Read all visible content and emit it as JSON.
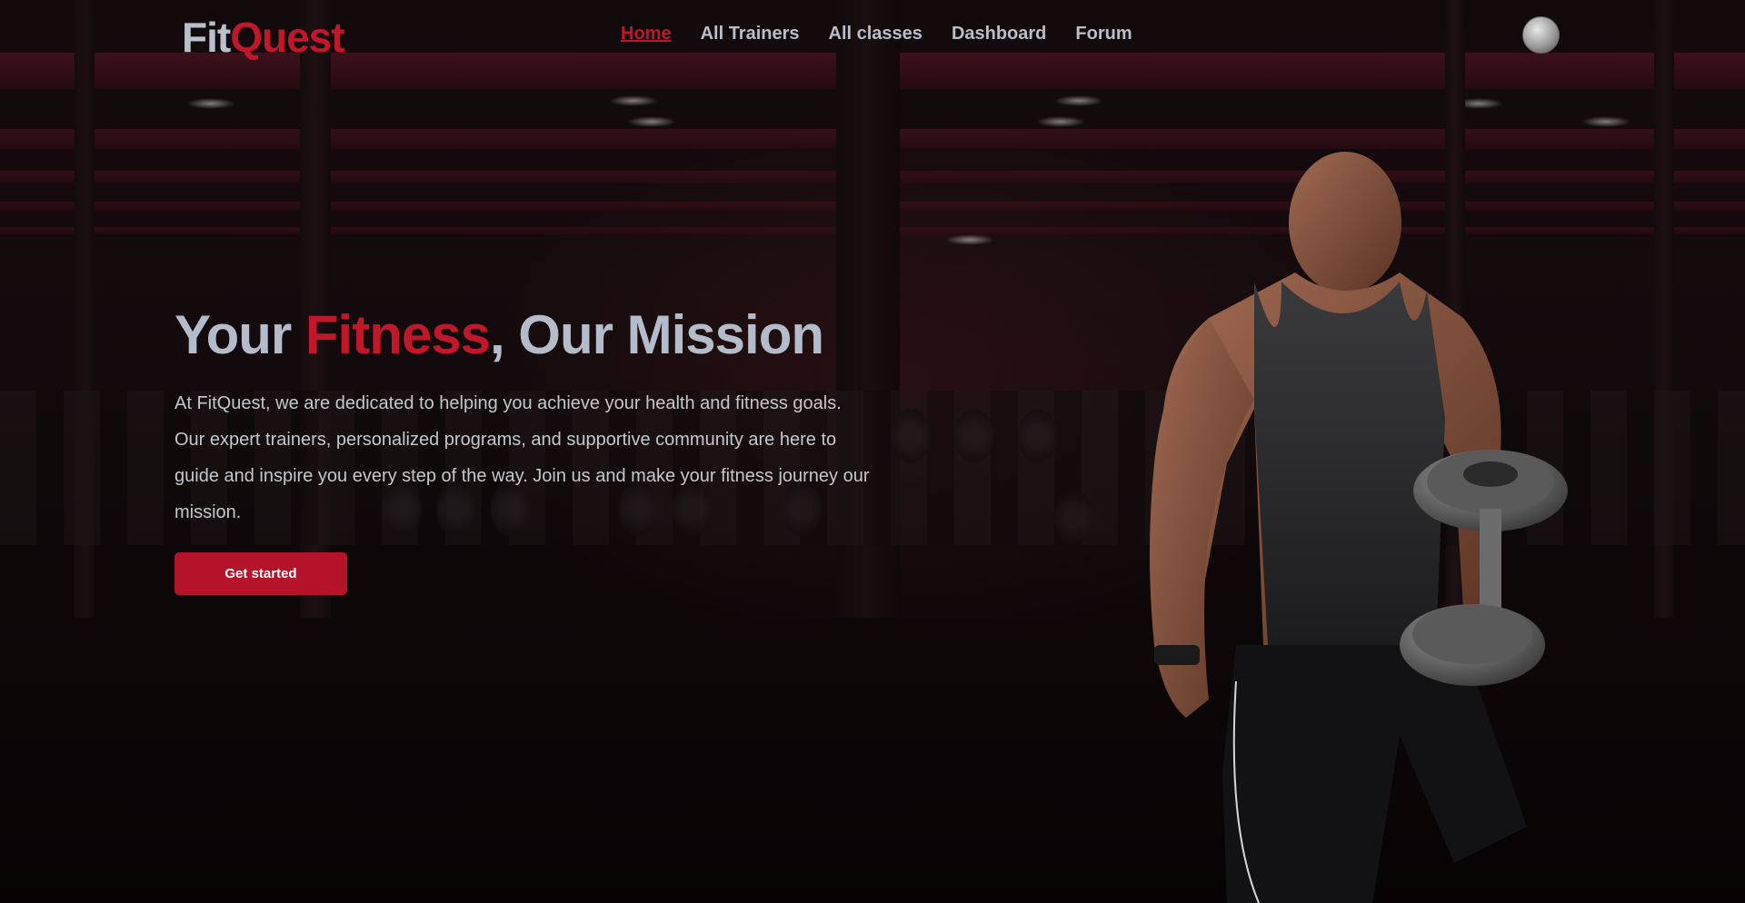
{
  "brand": {
    "part1": "Fit",
    "part2": "Quest"
  },
  "nav": {
    "items": [
      {
        "label": "Home",
        "active": true
      },
      {
        "label": "All Trainers",
        "active": false
      },
      {
        "label": "All classes",
        "active": false
      },
      {
        "label": "Dashboard",
        "active": false
      },
      {
        "label": "Forum",
        "active": false
      }
    ]
  },
  "hero": {
    "title_part1": "Your ",
    "title_accent": "Fitness",
    "title_part2": ", Our Mission",
    "description": "At FitQuest, we are dedicated to helping you achieve your health and fitness goals. Our expert trainers, personalized programs, and supportive community are here to guide and inspire you every step of the way. Join us and make your fitness journey our mission.",
    "cta_label": "Get started"
  },
  "colors": {
    "accent": "#c0172b",
    "nav_text": "#b8bfca",
    "button": "#b5132a",
    "background": "#140b0d"
  },
  "icons": {
    "avatar": "user-avatar-icon"
  }
}
